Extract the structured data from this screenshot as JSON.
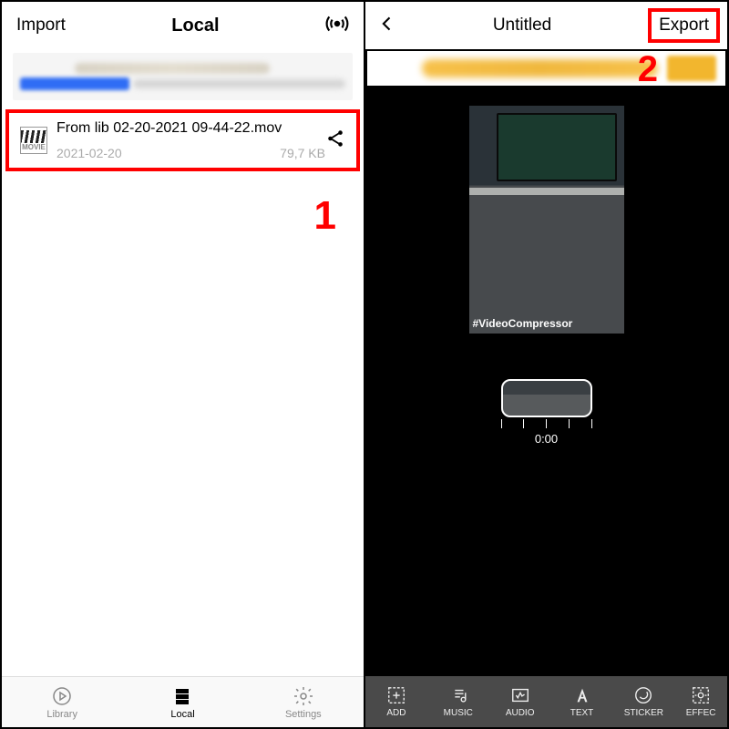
{
  "left": {
    "header": {
      "import": "Import",
      "title": "Local"
    },
    "file": {
      "name": "From lib 02-20-2021 09-44-22.mov",
      "date": "2021-02-20",
      "size": "79,7 KB",
      "thumb_label": "MOVIE"
    },
    "marker": "1",
    "tabs": {
      "library": "Library",
      "local": "Local",
      "settings": "Settings",
      "active": "local"
    }
  },
  "right": {
    "header": {
      "title": "Untitled",
      "export": "Export"
    },
    "marker": "2",
    "preview": {
      "watermark": "#VideoCompressor"
    },
    "timeline": {
      "time": "0:00"
    },
    "tools": {
      "add": "ADD",
      "music": "MUSIC",
      "audio": "AUDIO",
      "text": "TEXT",
      "sticker": "STICKER",
      "effect": "EFFEC"
    }
  },
  "colors": {
    "highlight": "#ff0000"
  }
}
